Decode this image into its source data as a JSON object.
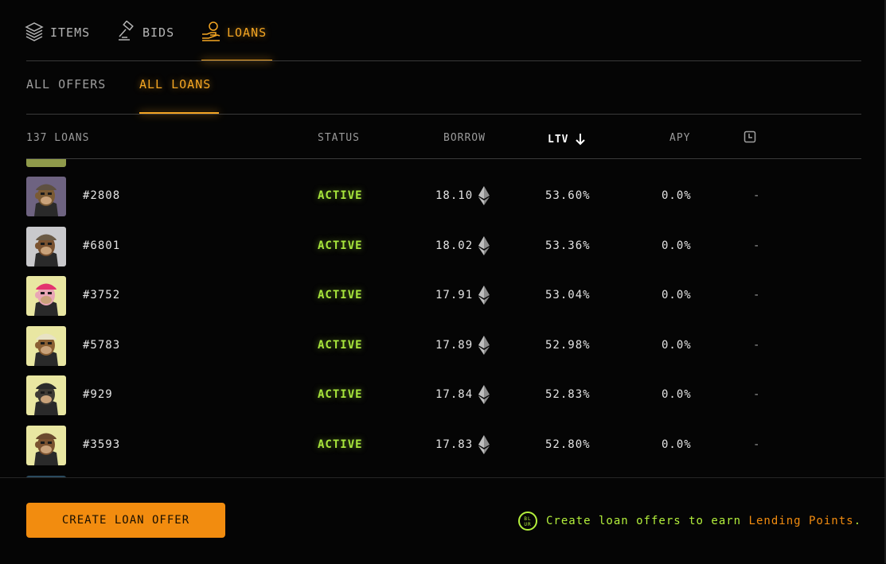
{
  "top_tabs": [
    {
      "label": "ITEMS",
      "icon": "layers-icon",
      "active": false
    },
    {
      "label": "BIDS",
      "icon": "gavel-icon",
      "active": false
    },
    {
      "label": "LOANS",
      "icon": "hand-coin-icon",
      "active": true
    }
  ],
  "sub_tabs": [
    {
      "label": "ALL OFFERS",
      "active": false
    },
    {
      "label": "ALL LOANS",
      "active": true
    }
  ],
  "table": {
    "count_label": "137 LOANS",
    "headers": {
      "status": "STATUS",
      "borrow": "BORROW",
      "ltv": "LTV",
      "apy": "APY"
    },
    "sort_icon": "arrow-down-icon",
    "time_icon": "clock-icon",
    "rows": [
      {
        "id": "#2808",
        "status": "ACTIVE",
        "borrow": "18.10",
        "ltv": "53.60%",
        "apy": "0.0%",
        "time": "-",
        "bg": "#6e6381",
        "fur": "#7a5a34",
        "hat": "#5e5040"
      },
      {
        "id": "#6801",
        "status": "ACTIVE",
        "borrow": "18.02",
        "ltv": "53.36%",
        "apy": "0.0%",
        "time": "-",
        "bg": "#c9c9cc",
        "fur": "#7a5230",
        "hat": "#6a5a45"
      },
      {
        "id": "#3752",
        "status": "ACTIVE",
        "borrow": "17.91",
        "ltv": "53.04%",
        "apy": "0.0%",
        "time": "-",
        "bg": "#e9e7a2",
        "fur": "#e9a6b5",
        "hat": "#e3346f"
      },
      {
        "id": "#5783",
        "status": "ACTIVE",
        "borrow": "17.89",
        "ltv": "52.98%",
        "apy": "0.0%",
        "time": "-",
        "bg": "#e9e7a2",
        "fur": "#8a5f33",
        "hat": "#e8e2c5"
      },
      {
        "id": "#929",
        "status": "ACTIVE",
        "borrow": "17.84",
        "ltv": "52.83%",
        "apy": "0.0%",
        "time": "-",
        "bg": "#e9e7a2",
        "fur": "#3e3a34",
        "hat": "#2b2b2b"
      },
      {
        "id": "#3593",
        "status": "ACTIVE",
        "borrow": "17.83",
        "ltv": "52.80%",
        "apy": "0.0%",
        "time": "-",
        "bg": "#e9e7a2",
        "fur": "#7a5230",
        "hat": "#6b4a2e"
      }
    ],
    "currency_icon": "ethereum-icon"
  },
  "footer": {
    "cta_label": "CREATE LOAN OFFER",
    "promo_prefix": "Create loan offers to earn ",
    "promo_highlight": "Lending Points",
    "promo_suffix": ".",
    "badge_icon": "blur-points-icon",
    "badge_text": "BL\nUR"
  },
  "colors": {
    "accent": "#f5a623",
    "active_status": "#a8e63c",
    "cta": "#f28c0f"
  }
}
